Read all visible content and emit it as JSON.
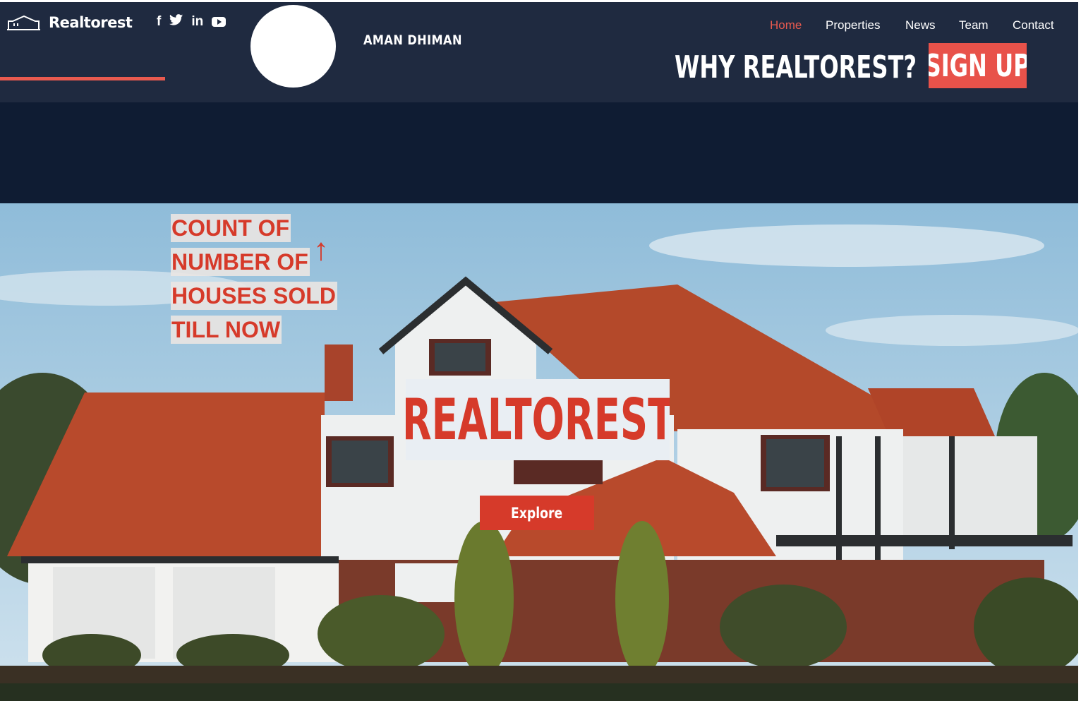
{
  "header": {
    "logo_text": "Realtorest",
    "logo_icon": "house-outline-icon",
    "social_icons": [
      "facebook-icon",
      "twitter-icon",
      "linkedin-icon",
      "youtube-icon"
    ],
    "social_glyphs": {
      "facebook": "f",
      "linkedin": "in"
    },
    "user_name": "AMAN DHIMAN",
    "nav": [
      {
        "label": "Home",
        "active": true
      },
      {
        "label": "Properties",
        "active": false
      },
      {
        "label": "News",
        "active": false
      },
      {
        "label": "Team",
        "active": false
      },
      {
        "label": "Contact",
        "active": false
      }
    ],
    "why_label": "WHY REALTOREST?",
    "signup_label": "SIGN UP"
  },
  "hero": {
    "counter_lines": [
      "COUNT OF",
      "NUMBER OF",
      "HOUSES SOLD",
      "TILL NOW"
    ],
    "arrow": "↑",
    "brand_title": "REALTOREST",
    "explore_label": "Explore"
  },
  "colors": {
    "accent": "#e85a4f",
    "brand_red": "#d63a2a",
    "topbar": "#1f2a40",
    "band": "#0f1c33"
  }
}
